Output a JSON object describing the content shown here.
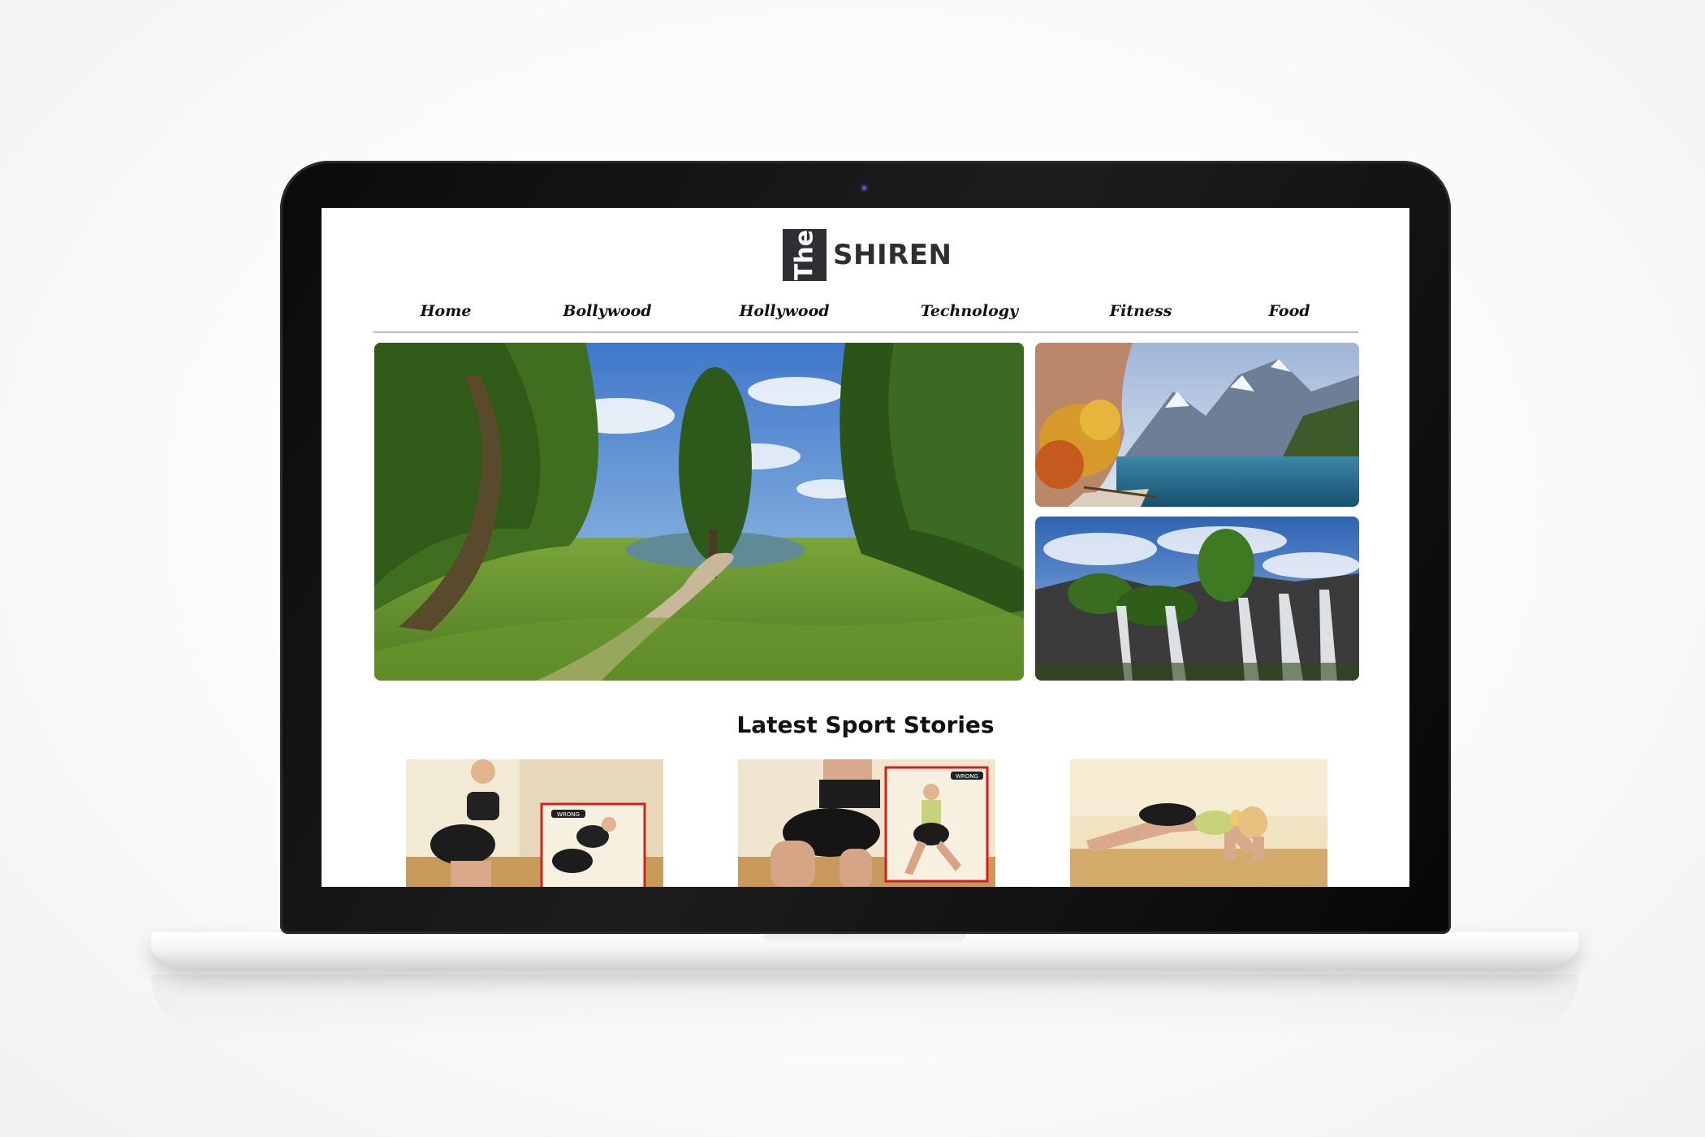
{
  "site": {
    "logo_badge": "The",
    "logo_name": "SHIREN"
  },
  "nav": {
    "items": [
      {
        "label": "Home"
      },
      {
        "label": "Bollywood"
      },
      {
        "label": "Hollywood"
      },
      {
        "label": "Technology"
      },
      {
        "label": "Fitness"
      },
      {
        "label": "Food"
      }
    ]
  },
  "featured": {
    "main_image": "forest-park-landscape",
    "side_images": [
      "mountain-lake-autumn",
      "waterfall-cliffs"
    ]
  },
  "latest": {
    "title": "Latest Sport Stories",
    "stories": [
      {
        "image": "squat-exercise-photo",
        "badge": "WRONG"
      },
      {
        "image": "lunge-exercise-photo",
        "badge": "WRONG"
      },
      {
        "image": "pushup-exercise-photo"
      }
    ]
  }
}
